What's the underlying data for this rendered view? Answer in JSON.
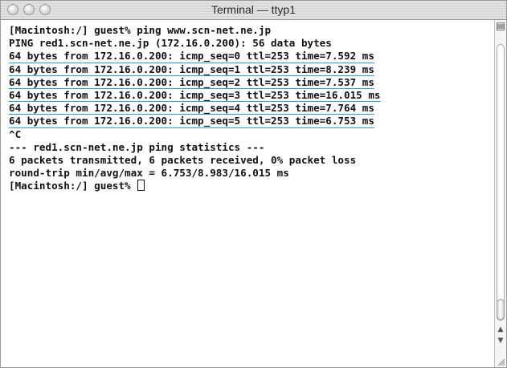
{
  "window": {
    "title": "Terminal — ttyp1"
  },
  "terminal": {
    "lines": [
      {
        "text": "[Macintosh:/] guest% ping www.scn-net.ne.jp",
        "highlighted": false
      },
      {
        "text": "PING red1.scn-net.ne.jp (172.16.0.200): 56 data bytes",
        "highlighted": false
      },
      {
        "text": "64 bytes from 172.16.0.200: icmp_seq=0 ttl=253 time=7.592 ms",
        "highlighted": true
      },
      {
        "text": "64 bytes from 172.16.0.200: icmp_seq=1 ttl=253 time=8.239 ms",
        "highlighted": true
      },
      {
        "text": "64 bytes from 172.16.0.200: icmp_seq=2 ttl=253 time=7.537 ms",
        "highlighted": true
      },
      {
        "text": "64 bytes from 172.16.0.200: icmp_seq=3 ttl=253 time=16.015 ms",
        "highlighted": true
      },
      {
        "text": "64 bytes from 172.16.0.200: icmp_seq=4 ttl=253 time=7.764 ms",
        "highlighted": true
      },
      {
        "text": "64 bytes from 172.16.0.200: icmp_seq=5 ttl=253 time=6.753 ms",
        "highlighted": true
      },
      {
        "text": "^C",
        "highlighted": false
      },
      {
        "text": "--- red1.scn-net.ne.jp ping statistics ---",
        "highlighted": false
      },
      {
        "text": "6 packets transmitted, 6 packets received, 0% packet loss",
        "highlighted": false
      },
      {
        "text": "round-trip min/avg/max = 6.753/8.983/16.015 ms",
        "highlighted": false
      },
      {
        "text": "[Macintosh:/] guest% ",
        "highlighted": false,
        "cursor": true
      }
    ]
  },
  "colors": {
    "highlight_underline": "#2a9dd6",
    "text": "#111111",
    "background": "#ffffff"
  },
  "scrollbar": {
    "position_fraction": 1.0
  },
  "icons": {
    "close": "close-button-icon",
    "minimize": "minimize-button-icon",
    "zoom": "zoom-button-icon",
    "split": "split-pane-icon",
    "up": "arrow-up-icon",
    "down": "arrow-down-icon",
    "resize": "resize-grip-icon"
  }
}
